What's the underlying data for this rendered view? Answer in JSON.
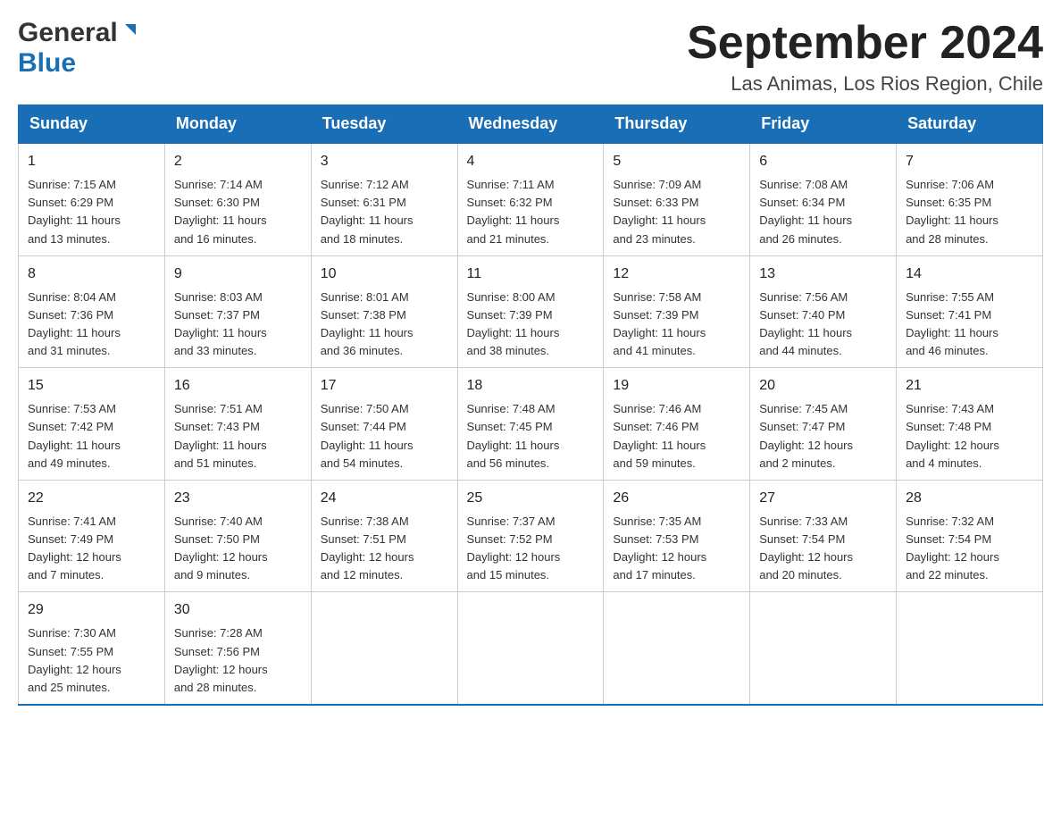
{
  "header": {
    "logo_general": "General",
    "logo_blue": "Blue",
    "month_title": "September 2024",
    "location": "Las Animas, Los Rios Region, Chile"
  },
  "days_of_week": [
    "Sunday",
    "Monday",
    "Tuesday",
    "Wednesday",
    "Thursday",
    "Friday",
    "Saturday"
  ],
  "weeks": [
    [
      {
        "day": "1",
        "sunrise": "7:15 AM",
        "sunset": "6:29 PM",
        "daylight": "11 hours and 13 minutes."
      },
      {
        "day": "2",
        "sunrise": "7:14 AM",
        "sunset": "6:30 PM",
        "daylight": "11 hours and 16 minutes."
      },
      {
        "day": "3",
        "sunrise": "7:12 AM",
        "sunset": "6:31 PM",
        "daylight": "11 hours and 18 minutes."
      },
      {
        "day": "4",
        "sunrise": "7:11 AM",
        "sunset": "6:32 PM",
        "daylight": "11 hours and 21 minutes."
      },
      {
        "day": "5",
        "sunrise": "7:09 AM",
        "sunset": "6:33 PM",
        "daylight": "11 hours and 23 minutes."
      },
      {
        "day": "6",
        "sunrise": "7:08 AM",
        "sunset": "6:34 PM",
        "daylight": "11 hours and 26 minutes."
      },
      {
        "day": "7",
        "sunrise": "7:06 AM",
        "sunset": "6:35 PM",
        "daylight": "11 hours and 28 minutes."
      }
    ],
    [
      {
        "day": "8",
        "sunrise": "8:04 AM",
        "sunset": "7:36 PM",
        "daylight": "11 hours and 31 minutes."
      },
      {
        "day": "9",
        "sunrise": "8:03 AM",
        "sunset": "7:37 PM",
        "daylight": "11 hours and 33 minutes."
      },
      {
        "day": "10",
        "sunrise": "8:01 AM",
        "sunset": "7:38 PM",
        "daylight": "11 hours and 36 minutes."
      },
      {
        "day": "11",
        "sunrise": "8:00 AM",
        "sunset": "7:39 PM",
        "daylight": "11 hours and 38 minutes."
      },
      {
        "day": "12",
        "sunrise": "7:58 AM",
        "sunset": "7:39 PM",
        "daylight": "11 hours and 41 minutes."
      },
      {
        "day": "13",
        "sunrise": "7:56 AM",
        "sunset": "7:40 PM",
        "daylight": "11 hours and 44 minutes."
      },
      {
        "day": "14",
        "sunrise": "7:55 AM",
        "sunset": "7:41 PM",
        "daylight": "11 hours and 46 minutes."
      }
    ],
    [
      {
        "day": "15",
        "sunrise": "7:53 AM",
        "sunset": "7:42 PM",
        "daylight": "11 hours and 49 minutes."
      },
      {
        "day": "16",
        "sunrise": "7:51 AM",
        "sunset": "7:43 PM",
        "daylight": "11 hours and 51 minutes."
      },
      {
        "day": "17",
        "sunrise": "7:50 AM",
        "sunset": "7:44 PM",
        "daylight": "11 hours and 54 minutes."
      },
      {
        "day": "18",
        "sunrise": "7:48 AM",
        "sunset": "7:45 PM",
        "daylight": "11 hours and 56 minutes."
      },
      {
        "day": "19",
        "sunrise": "7:46 AM",
        "sunset": "7:46 PM",
        "daylight": "11 hours and 59 minutes."
      },
      {
        "day": "20",
        "sunrise": "7:45 AM",
        "sunset": "7:47 PM",
        "daylight": "12 hours and 2 minutes."
      },
      {
        "day": "21",
        "sunrise": "7:43 AM",
        "sunset": "7:48 PM",
        "daylight": "12 hours and 4 minutes."
      }
    ],
    [
      {
        "day": "22",
        "sunrise": "7:41 AM",
        "sunset": "7:49 PM",
        "daylight": "12 hours and 7 minutes."
      },
      {
        "day": "23",
        "sunrise": "7:40 AM",
        "sunset": "7:50 PM",
        "daylight": "12 hours and 9 minutes."
      },
      {
        "day": "24",
        "sunrise": "7:38 AM",
        "sunset": "7:51 PM",
        "daylight": "12 hours and 12 minutes."
      },
      {
        "day": "25",
        "sunrise": "7:37 AM",
        "sunset": "7:52 PM",
        "daylight": "12 hours and 15 minutes."
      },
      {
        "day": "26",
        "sunrise": "7:35 AM",
        "sunset": "7:53 PM",
        "daylight": "12 hours and 17 minutes."
      },
      {
        "day": "27",
        "sunrise": "7:33 AM",
        "sunset": "7:54 PM",
        "daylight": "12 hours and 20 minutes."
      },
      {
        "day": "28",
        "sunrise": "7:32 AM",
        "sunset": "7:54 PM",
        "daylight": "12 hours and 22 minutes."
      }
    ],
    [
      {
        "day": "29",
        "sunrise": "7:30 AM",
        "sunset": "7:55 PM",
        "daylight": "12 hours and 25 minutes."
      },
      {
        "day": "30",
        "sunrise": "7:28 AM",
        "sunset": "7:56 PM",
        "daylight": "12 hours and 28 minutes."
      },
      null,
      null,
      null,
      null,
      null
    ]
  ],
  "labels": {
    "sunrise": "Sunrise:",
    "sunset": "Sunset:",
    "daylight": "Daylight:"
  }
}
